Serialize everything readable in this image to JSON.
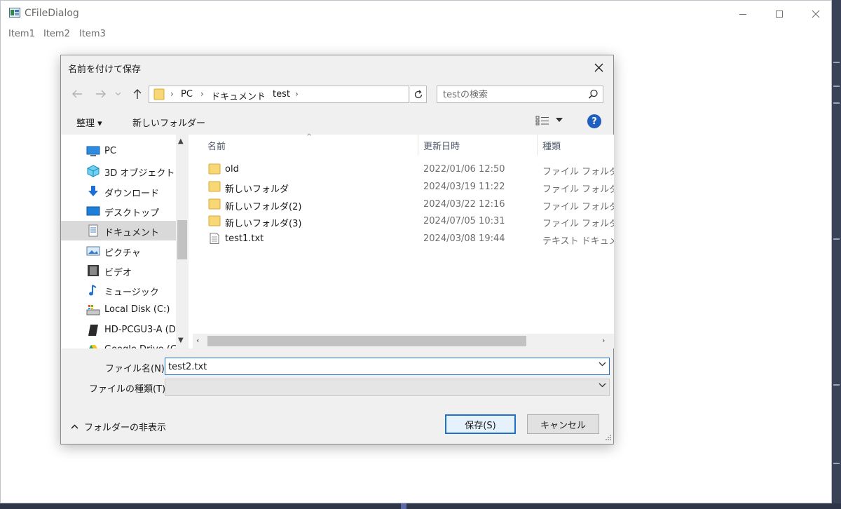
{
  "app": {
    "title": "CFileDialog",
    "menu": [
      "Item1",
      "Item2",
      "Item3"
    ]
  },
  "dialog": {
    "title": "名前を付けて保存",
    "breadcrumb": [
      "PC",
      "ドキュメント",
      "test"
    ],
    "search_placeholder": "testの検索",
    "toolbar": {
      "organize": "整理 ▾",
      "new_folder": "新しいフォルダー"
    },
    "nav_items": [
      {
        "label": "PC",
        "icon": "pc-icon"
      },
      {
        "label": "3D オブジェクト",
        "icon": "cube-icon"
      },
      {
        "label": "ダウンロード",
        "icon": "download-icon"
      },
      {
        "label": "デスクトップ",
        "icon": "desktop-icon"
      },
      {
        "label": "ドキュメント",
        "icon": "document-icon",
        "selected": true
      },
      {
        "label": "ピクチャ",
        "icon": "picture-icon"
      },
      {
        "label": "ビデオ",
        "icon": "video-icon"
      },
      {
        "label": "ミュージック",
        "icon": "music-icon"
      },
      {
        "label": "Local Disk (C:)",
        "icon": "disk-icon"
      },
      {
        "label": "HD-PCGU3-A (D",
        "icon": "external-disk-icon"
      },
      {
        "label": "Google Drive (G",
        "icon": "google-drive-icon"
      }
    ],
    "columns": {
      "name": "名前",
      "date": "更新日時",
      "type": "種類"
    },
    "files": [
      {
        "name": "old",
        "date": "2022/01/06 12:50",
        "type": "ファイル フォルダー",
        "icon": "folder-icon"
      },
      {
        "name": "新しいフォルダ",
        "date": "2024/03/19 11:22",
        "type": "ファイル フォルダー",
        "icon": "folder-icon"
      },
      {
        "name": "新しいフォルダ(2)",
        "date": "2024/03/22 12:16",
        "type": "ファイル フォルダー",
        "icon": "folder-icon"
      },
      {
        "name": "新しいフォルダ(3)",
        "date": "2024/07/05 10:31",
        "type": "ファイル フォルダー",
        "icon": "folder-icon"
      },
      {
        "name": "test1.txt",
        "date": "2024/03/08 19:44",
        "type": "テキスト ドキュメント",
        "icon": "text-file-icon"
      }
    ],
    "filename_label": "ファイル名(N):",
    "filename_value": "test2.txt",
    "filetype_label": "ファイルの種類(T):",
    "filetype_value": "",
    "hide_folders": "フォルダーの非表示",
    "save_button": "保存(S)",
    "cancel_button": "キャンセル",
    "colors": {
      "accent": "#1f70c8",
      "folder": "#f8d775",
      "selected": "#d9d9d9"
    }
  }
}
